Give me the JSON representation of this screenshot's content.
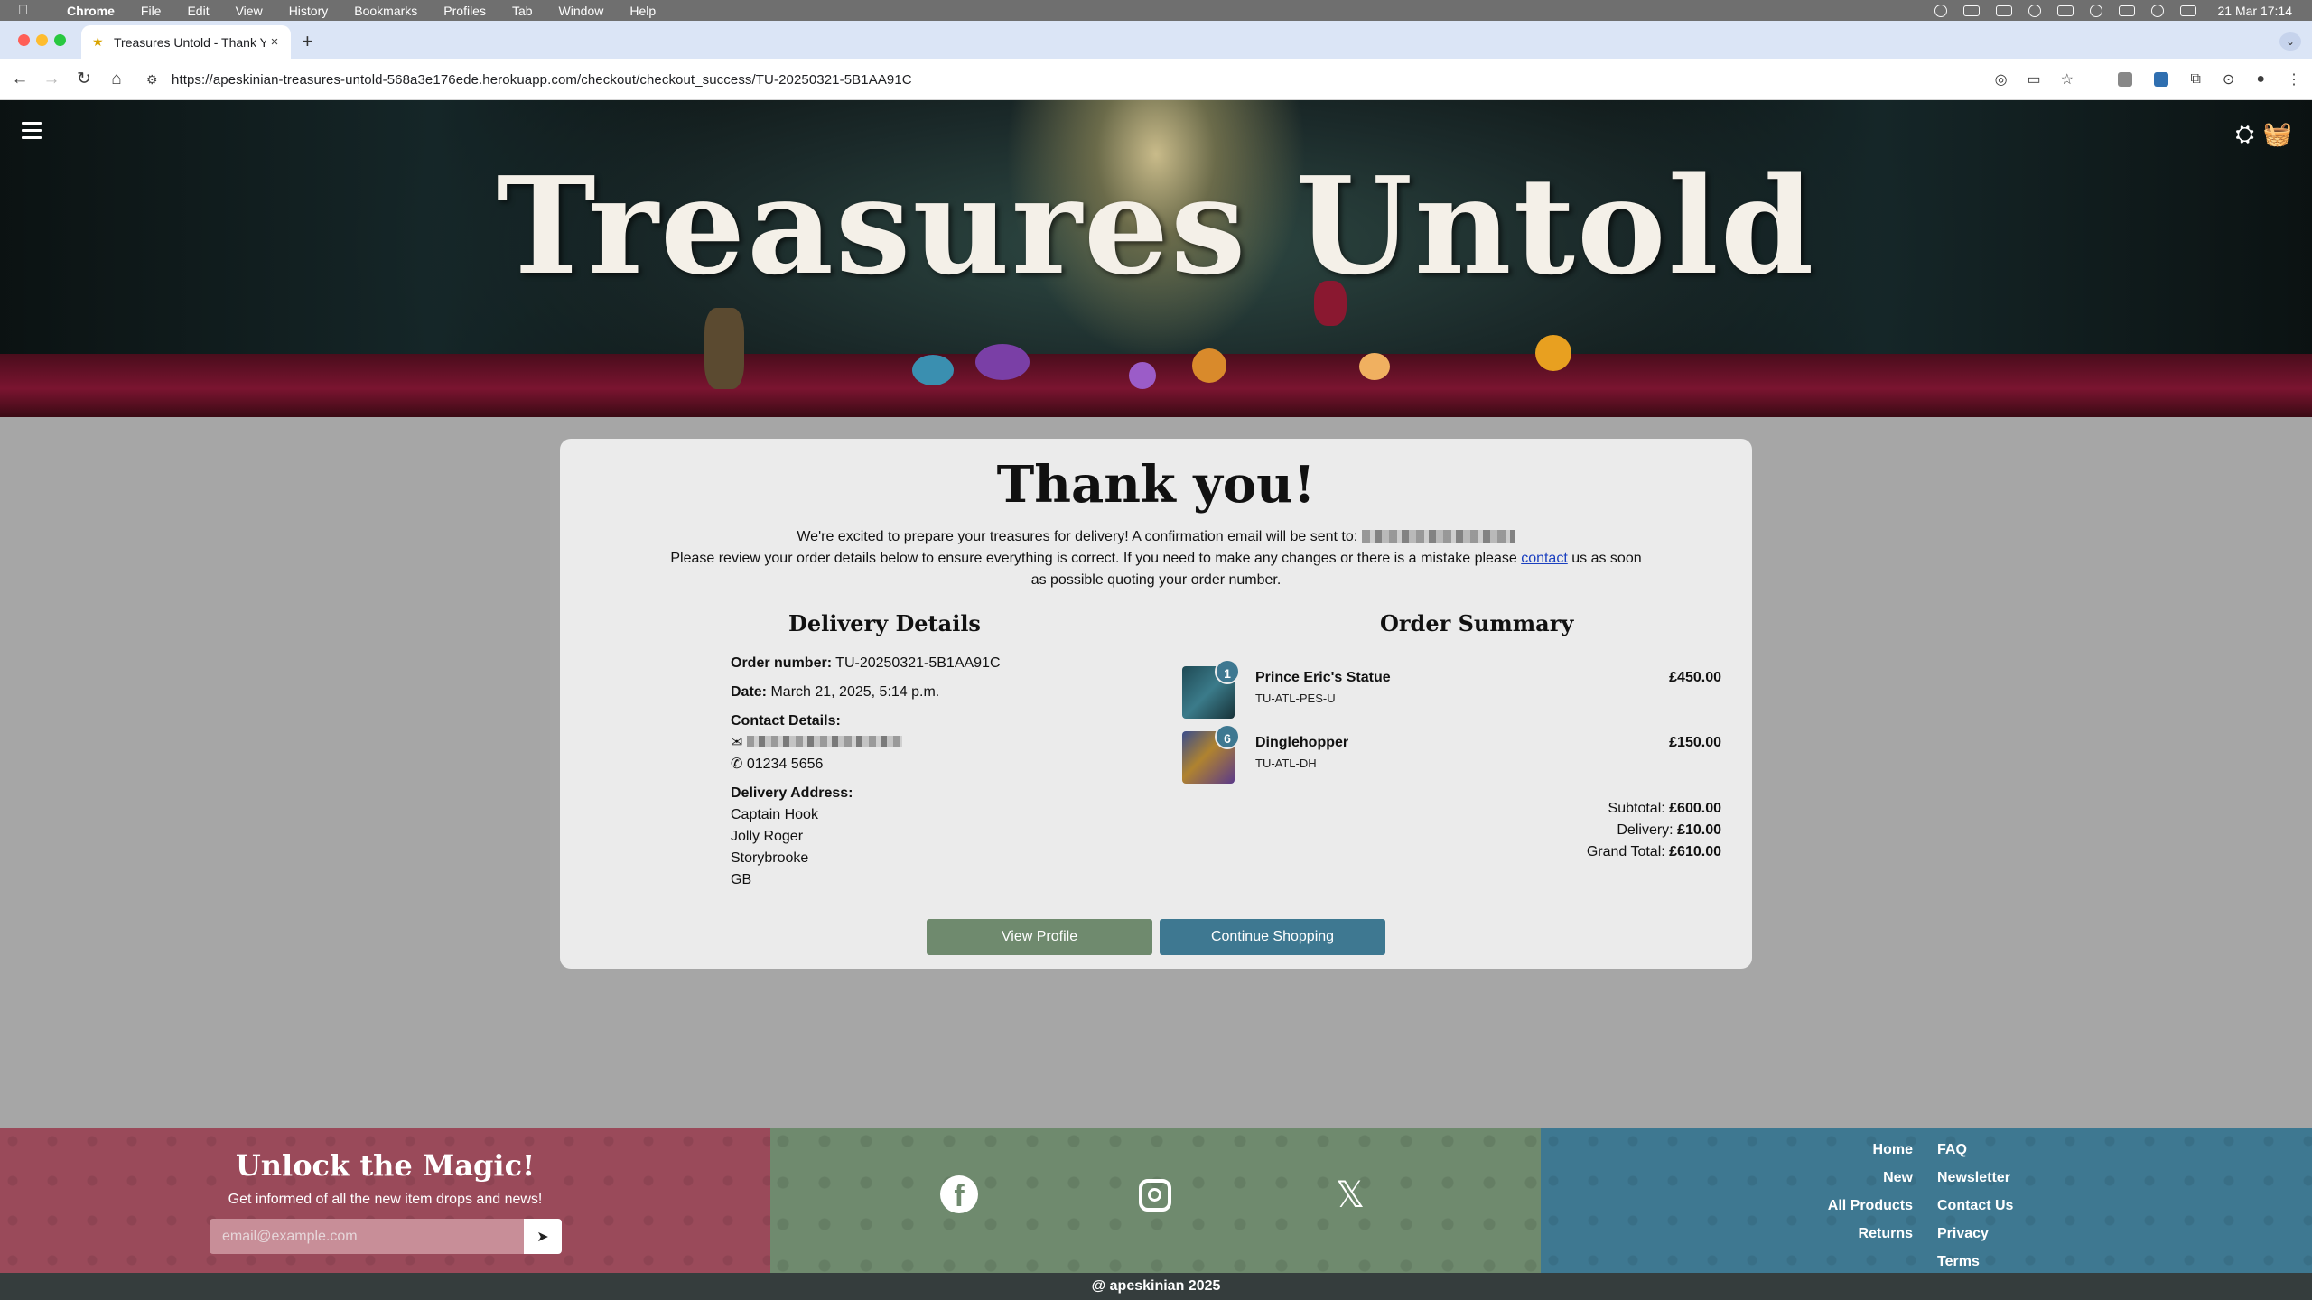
{
  "menubar": {
    "app": "Chrome",
    "items": [
      "File",
      "Edit",
      "View",
      "History",
      "Bookmarks",
      "Profiles",
      "Tab",
      "Window",
      "Help"
    ],
    "clock": "21 Mar  17:14"
  },
  "browser": {
    "tab_title": "Treasures Untold - Thank You",
    "url": "https://apeskinian-treasures-untold-568a3e176ede.herokuapp.com/checkout/checkout_success/TU-20250321-5B1AA91C"
  },
  "hero": {
    "brand": "Treasures Untold"
  },
  "card": {
    "title": "Thank you!",
    "intro_line1": "We're excited to prepare your treasures for delivery! A confirmation email will be sent to:",
    "intro_line2_pre": "Please review your order details below to ensure everything is correct. If you need to make any changes or there is a mistake please",
    "contact_link": "contact",
    "intro_line2_post": "us as soon as possible quoting your order number.",
    "delivery_title": "Delivery Details",
    "order_title": "Order Summary",
    "order_number_label": "Order number:",
    "order_number": "TU-20250321-5B1AA91C",
    "date_label": "Date:",
    "date": "March 21, 2025, 5:14 p.m.",
    "contact_label": "Contact Details:",
    "phone": "01234 5656",
    "address_label": "Delivery Address:",
    "address": [
      "Captain Hook",
      "Jolly Roger",
      "Storybrooke",
      "GB"
    ],
    "items": [
      {
        "qty": "1",
        "name": "Prince Eric's Statue",
        "sku": "TU-ATL-PES-U",
        "price": "£450.00"
      },
      {
        "qty": "6",
        "name": "Dinglehopper",
        "sku": "TU-ATL-DH",
        "price": "£150.00"
      }
    ],
    "subtotal_label": "Subtotal:",
    "subtotal": "£600.00",
    "delivery_label": "Delivery:",
    "delivery": "£10.00",
    "grand_total_label": "Grand Total:",
    "grand_total": "£610.00",
    "view_profile": "View Profile",
    "continue_shopping": "Continue Shopping"
  },
  "footer": {
    "heading": "Unlock the Magic!",
    "sub": "Get informed of all the new item drops and news!",
    "email_placeholder": "email@example.com",
    "links_left": [
      "Home",
      "New",
      "All Products",
      "Returns"
    ],
    "links_right": [
      "FAQ",
      "Newsletter",
      "Contact Us",
      "Privacy",
      "Terms"
    ],
    "copyright": "@ apeskinian 2025"
  },
  "colors": {
    "accent_blue": "#3e7891",
    "accent_green": "#6f8a6e",
    "accent_red": "#9a4a5a"
  }
}
